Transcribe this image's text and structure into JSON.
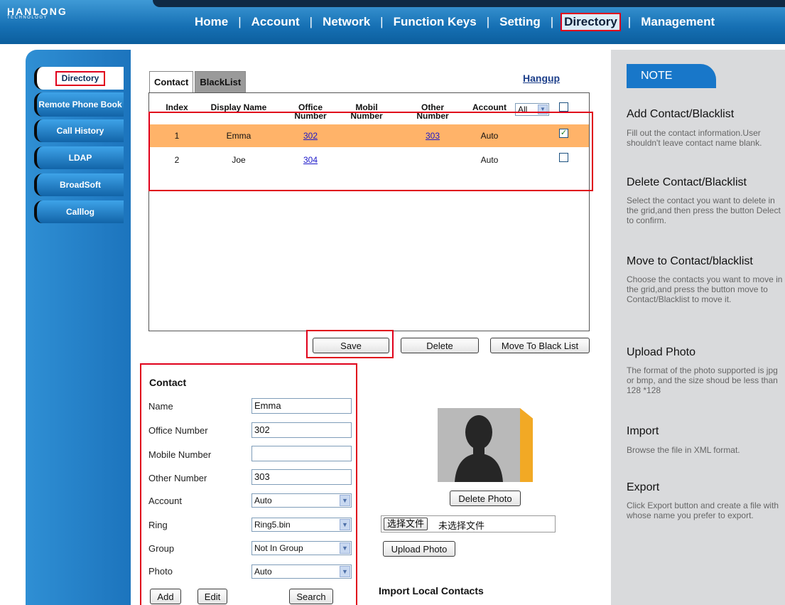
{
  "logo": {
    "name": "HANLONG",
    "sub": "TECHNOLOGY"
  },
  "nav": {
    "items": [
      {
        "label": "Home"
      },
      {
        "label": "Account"
      },
      {
        "label": "Network"
      },
      {
        "label": "Function Keys"
      },
      {
        "label": "Setting"
      },
      {
        "label": "Directory"
      },
      {
        "label": "Management"
      }
    ]
  },
  "sidebar": {
    "items": [
      {
        "label": "Directory"
      },
      {
        "label": "Remote Phone Book"
      },
      {
        "label": "Call History"
      },
      {
        "label": "LDAP"
      },
      {
        "label": "BroadSoft"
      },
      {
        "label": "Calllog"
      }
    ]
  },
  "tabs": {
    "contact": "Contact",
    "blacklist": "BlackList"
  },
  "hangup": "Hangup",
  "grid": {
    "headers": {
      "index": "Index",
      "display_name": "Display Name",
      "office": "Office Number",
      "mobile": "Mobil Number",
      "other": "Other Number",
      "account": "Account"
    },
    "account_filter": "All",
    "rows": [
      {
        "index": "1",
        "name": "Emma",
        "office": "302",
        "mobile": "",
        "other": "303",
        "account": "Auto",
        "checked": "✓"
      },
      {
        "index": "2",
        "name": "Joe",
        "office": "304",
        "mobile": "",
        "other": "",
        "account": "Auto",
        "checked": ""
      }
    ]
  },
  "actions": {
    "save": "Save",
    "delete": "Delete",
    "move": "Move To Black List"
  },
  "form": {
    "title": "Contact",
    "name_label": "Name",
    "name_value": "Emma",
    "office_label": "Office Number",
    "office_value": "302",
    "mobile_label": "Mobile Number",
    "mobile_value": "",
    "other_label": "Other Number",
    "other_value": "303",
    "account_label": "Account",
    "account_value": "Auto",
    "ring_label": "Ring",
    "ring_value": "Ring5.bin",
    "group_label": "Group",
    "group_value": "Not In Group",
    "photo_label": "Photo",
    "photo_value": "Auto",
    "add": "Add",
    "edit": "Edit",
    "search": "Search"
  },
  "photo": {
    "delete": "Delete Photo",
    "choose_file": "选择文件",
    "no_file": "未选择文件",
    "upload": "Upload Photo"
  },
  "import_title": "Import Local Contacts",
  "notes": {
    "tab": "NOTE",
    "sections": [
      {
        "title": "Add Contact/Blacklist",
        "text": "Fill out the contact information.User shouldn't leave contact name blank."
      },
      {
        "title": "Delete Contact/Blacklist",
        "text": "Select the contact you want to delete in the grid,and then press the button Delect to confirm."
      },
      {
        "title": "Move to Contact/blacklist",
        "text": "Choose the contacts you want to move in the grid,and press the button move to Contact/Blacklist to move it."
      },
      {
        "title": "Upload Photo",
        "text": "The format of the photo supported is jpg or bmp, and the size shoud be less than 128 *128"
      },
      {
        "title": "Import",
        "text": "Browse the file in XML format."
      },
      {
        "title": "Export",
        "text": "Click Export button and create a file with whose name you prefer to export."
      }
    ]
  },
  "colors": {
    "accent_blue": "#1877c9",
    "selected_row": "#ffb369",
    "highlight_red": "#e0001b"
  }
}
